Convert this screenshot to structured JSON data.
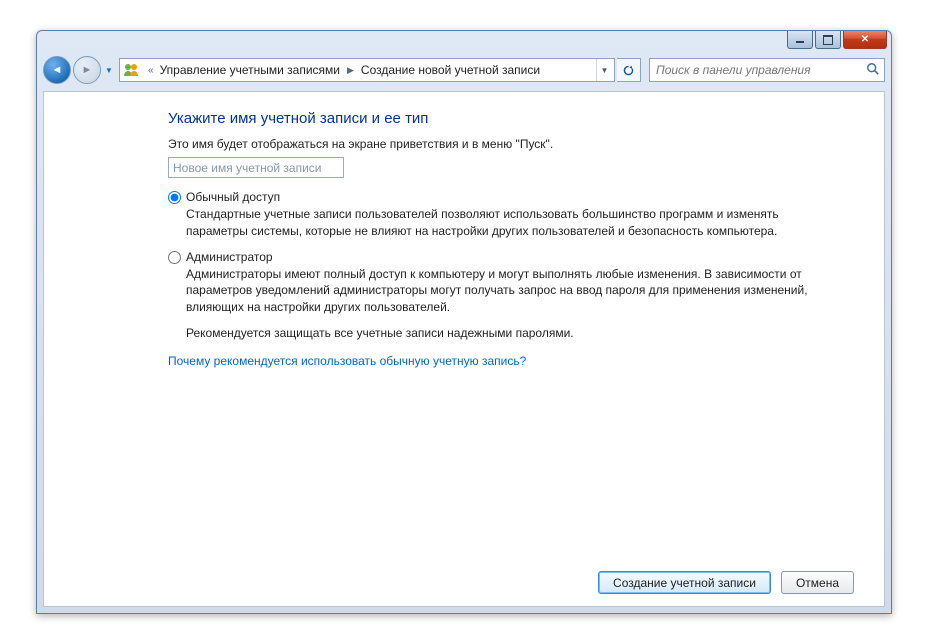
{
  "window_controls": {
    "minimize": "min",
    "maximize": "max",
    "close": "close"
  },
  "breadcrumb": {
    "prefix": "«",
    "item1": "Управление учетными записями",
    "item2": "Создание новой учетной записи"
  },
  "search": {
    "placeholder": "Поиск в панели управления"
  },
  "page": {
    "title": "Укажите имя учетной записи и ее тип",
    "subtitle": "Это имя будет отображаться на экране приветствия и в меню \"Пуск\".",
    "input_placeholder": "Новое имя учетной записи"
  },
  "options": {
    "standard": {
      "label": "Обычный доступ",
      "desc": "Стандартные учетные записи пользователей позволяют использовать большинство программ и изменять параметры системы, которые не влияют на настройки других пользователей и безопасность компьютера.",
      "checked": true
    },
    "admin": {
      "label": "Администратор",
      "desc": "Администраторы имеют полный доступ к компьютеру и могут выполнять любые изменения. В зависимости от параметров уведомлений администраторы могут получать запрос на ввод пароля для применения изменений, влияющих на настройки других пользователей.",
      "checked": false
    }
  },
  "recommendation": "Рекомендуется защищать все учетные записи надежными паролями.",
  "help_link": "Почему рекомендуется использовать обычную учетную запись?",
  "buttons": {
    "create": "Создание учетной записи",
    "cancel": "Отмена"
  }
}
